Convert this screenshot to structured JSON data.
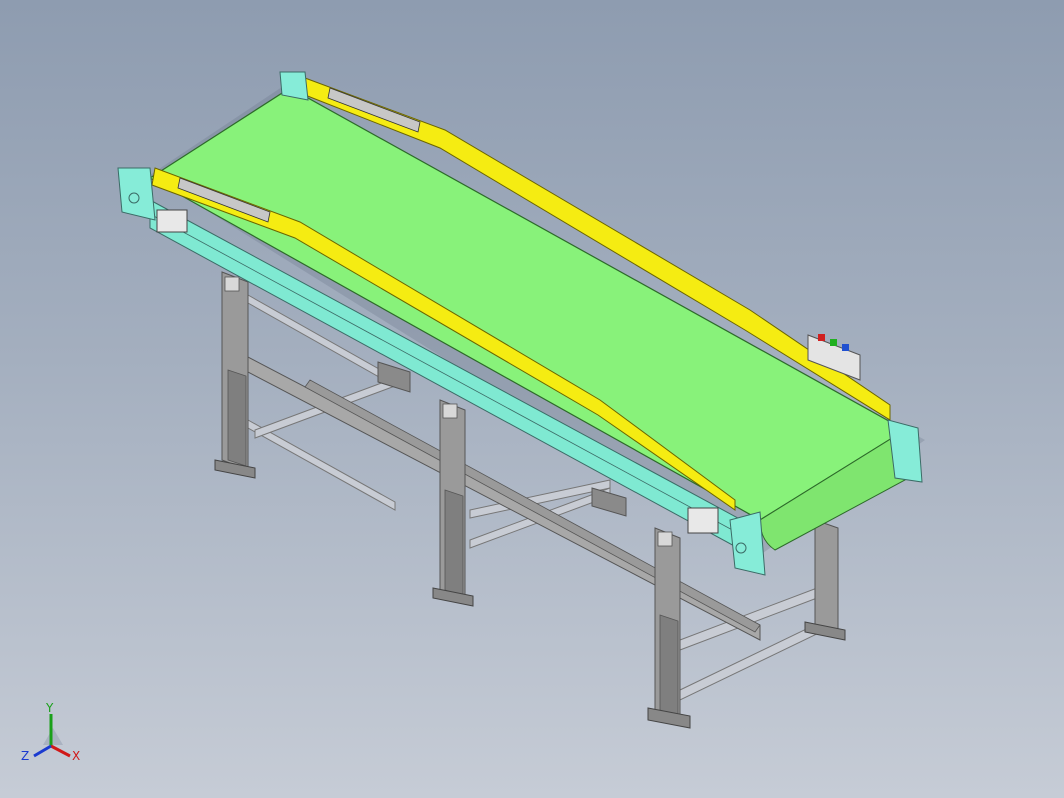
{
  "viewport": {
    "background_top": "#8e9cb0",
    "background_bottom": "#c6ccd6"
  },
  "model": {
    "colors": {
      "belt": "#88f27a",
      "side_guard": "#f5ec12",
      "frame_side": "#7fe9d2",
      "end_block": "#86ecd8",
      "legs": "#8c8c8c",
      "cross_beams": "#c0c4cc"
    },
    "icons": [
      "motor-box-icon",
      "end-block-icon",
      "leg-icon"
    ]
  },
  "triad": {
    "y_label": "Y",
    "x_label": "X",
    "z_label": "Z",
    "y_color": "#1aa01a",
    "x_color": "#d01818",
    "z_color": "#1a3ad0"
  }
}
